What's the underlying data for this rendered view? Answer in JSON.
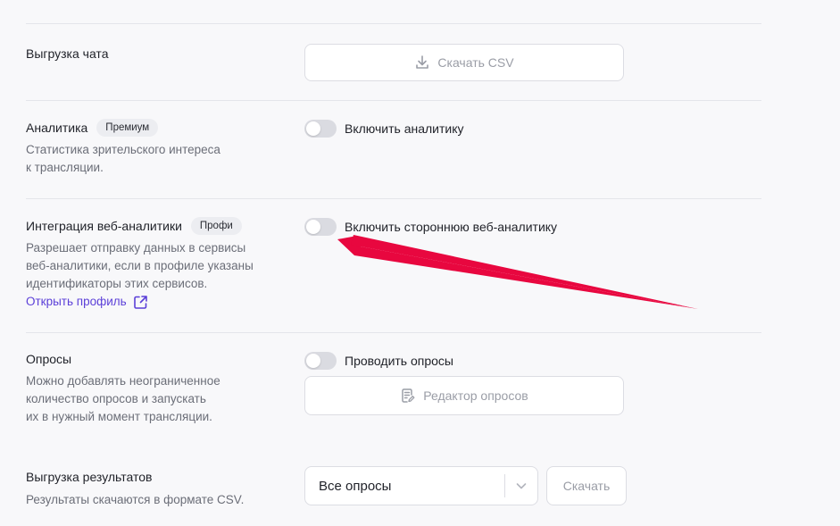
{
  "chat_export": {
    "title": "Выгрузка чата",
    "button_label": "Скачать CSV",
    "button_icon": "download-icon"
  },
  "analytics": {
    "title": "Аналитика",
    "badge": "Премиум",
    "desc_line1": "Статистика зрительского интереса",
    "desc_line2": "к трансляции.",
    "toggle_label": "Включить аналитику",
    "toggle_on": false
  },
  "web_analytics": {
    "title": "Интеграция веб-аналитики",
    "badge": "Профи",
    "desc_line1": "Разрешает отправку данных в сервисы",
    "desc_line2": "веб-аналитики, если в профиле указаны",
    "desc_line3": "идентификаторы этих сервисов.",
    "link_label": "Открыть профиль",
    "link_icon": "external-link-icon",
    "toggle_label": "Включить стороннюю веб-аналитику",
    "toggle_on": false
  },
  "polls": {
    "title": "Опросы",
    "desc_line1": "Можно добавлять неограниченное",
    "desc_line2": "количество опросов и запускать",
    "desc_line3": "их в нужный момент трансляции.",
    "toggle_label": "Проводить опросы",
    "toggle_on": false,
    "editor_label": "Редактор опросов",
    "editor_icon": "clipboard-edit-icon"
  },
  "results_export": {
    "title": "Выгрузка результатов",
    "desc": "Результаты скачаются в формате CSV.",
    "select_value": "Все опросы",
    "download_label": "Скачать"
  },
  "colors": {
    "accent_link": "#5b3fd8",
    "annotation_arrow": "#e8073f",
    "toggle_off": "#dadbe1"
  }
}
